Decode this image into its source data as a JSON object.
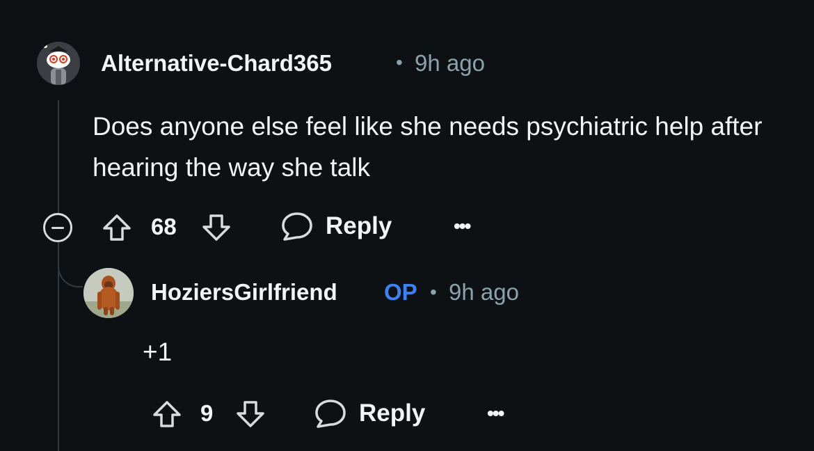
{
  "comment": {
    "username": "Alternative-Chard365",
    "separator": "•",
    "time": "9h ago",
    "body": "Does anyone else feel like she needs psychiatric help after hearing the way she talk",
    "votes": "68",
    "reply_label": "Reply",
    "more_label": "•••",
    "avatar_icon": "snoo-avatar-icon"
  },
  "reply": {
    "username": "HoziersGirlfriend",
    "op_badge": "OP",
    "separator": "•",
    "time": "9h ago",
    "body": "+1",
    "votes": "9",
    "reply_label": "Reply",
    "more_label": "•••",
    "avatar_icon": "orangutan-avatar-icon"
  },
  "colors": {
    "background": "#0e1113",
    "text": "#f2f4f5",
    "meta": "#8ba2ad",
    "op_badge": "#3b82f6",
    "thread_line": "#33393d"
  }
}
